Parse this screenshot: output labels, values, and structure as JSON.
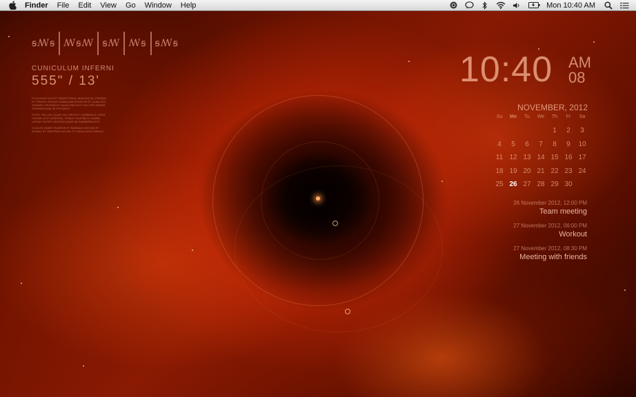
{
  "menubar": {
    "apple_icon": "apple-icon",
    "items": [
      "Finder",
      "File",
      "Edit",
      "View",
      "Go",
      "Window",
      "Help"
    ],
    "status_icons": [
      "power-icon",
      "speech-bubble-icon",
      "bluetooth-icon",
      "wifi-icon",
      "volume-icon",
      "battery-icon"
    ],
    "clock": "Mon 10:40 AM",
    "search_icon": "search-icon",
    "list_icon": "notification-list-icon"
  },
  "left_widget": {
    "glyphs": [
      "ꞩꟿꞩ",
      "ꟿꞩꟿ",
      "ꞩꟿ",
      "ꟿꞩ",
      "ꞩꟿꞩ"
    ],
    "title": "CUNICULUM INFERNI",
    "value": "555\" / 13'",
    "text_blocks": [
      "PLUVIA BIS DUO ET SEMPITERNA, MALEDICTA, FRIGIDA ET GRAVIS; MODUS NUMQUAM NOVATUR ET QUALITAS. GRANDO CRASSA ET AQUA TINCTA ET NIX PER AEREM TENEBROSUM SE EFFUNDIT.",
      "PUTET TELLUS, QUAE HOC RECIPIT. CERBERUS, FERA CRUDELIS ET DIVERSA, TRIBUS FAUCIBUS CANINE LATRAT SUPER GENTEM QUAE IBI SUBMERSA EST.",
      "OCULOS HABET RUBROS ET BARBAM UNCTAM ET ATRAM, ET VENTREM LATUM, ET UNGULATAS MANUS."
    ]
  },
  "right_widget": {
    "time": "10:40",
    "ampm": "AM",
    "seconds": "08",
    "calendar": {
      "title": "NOVEMBER, 2012",
      "weekdays": [
        "Su",
        "Mo",
        "Tu",
        "We",
        "Th",
        "Fr",
        "Sa"
      ],
      "days": [
        "",
        "",
        "",
        "",
        "1",
        "2",
        "3",
        "4",
        "5",
        "6",
        "7",
        "8",
        "9",
        "10",
        "11",
        "12",
        "13",
        "14",
        "15",
        "16",
        "17",
        "18",
        "19",
        "20",
        "21",
        "22",
        "23",
        "24",
        "25",
        "26",
        "27",
        "28",
        "29",
        "30",
        ""
      ],
      "today": "26"
    },
    "events": [
      {
        "date": "26 November 2012, 12:00 PM",
        "title": "Team meeting"
      },
      {
        "date": "27 November 2012, 06:00 PM",
        "title": "Workout"
      },
      {
        "date": "27 November 2012, 08:30 PM",
        "title": "Meeting with friends"
      }
    ]
  }
}
